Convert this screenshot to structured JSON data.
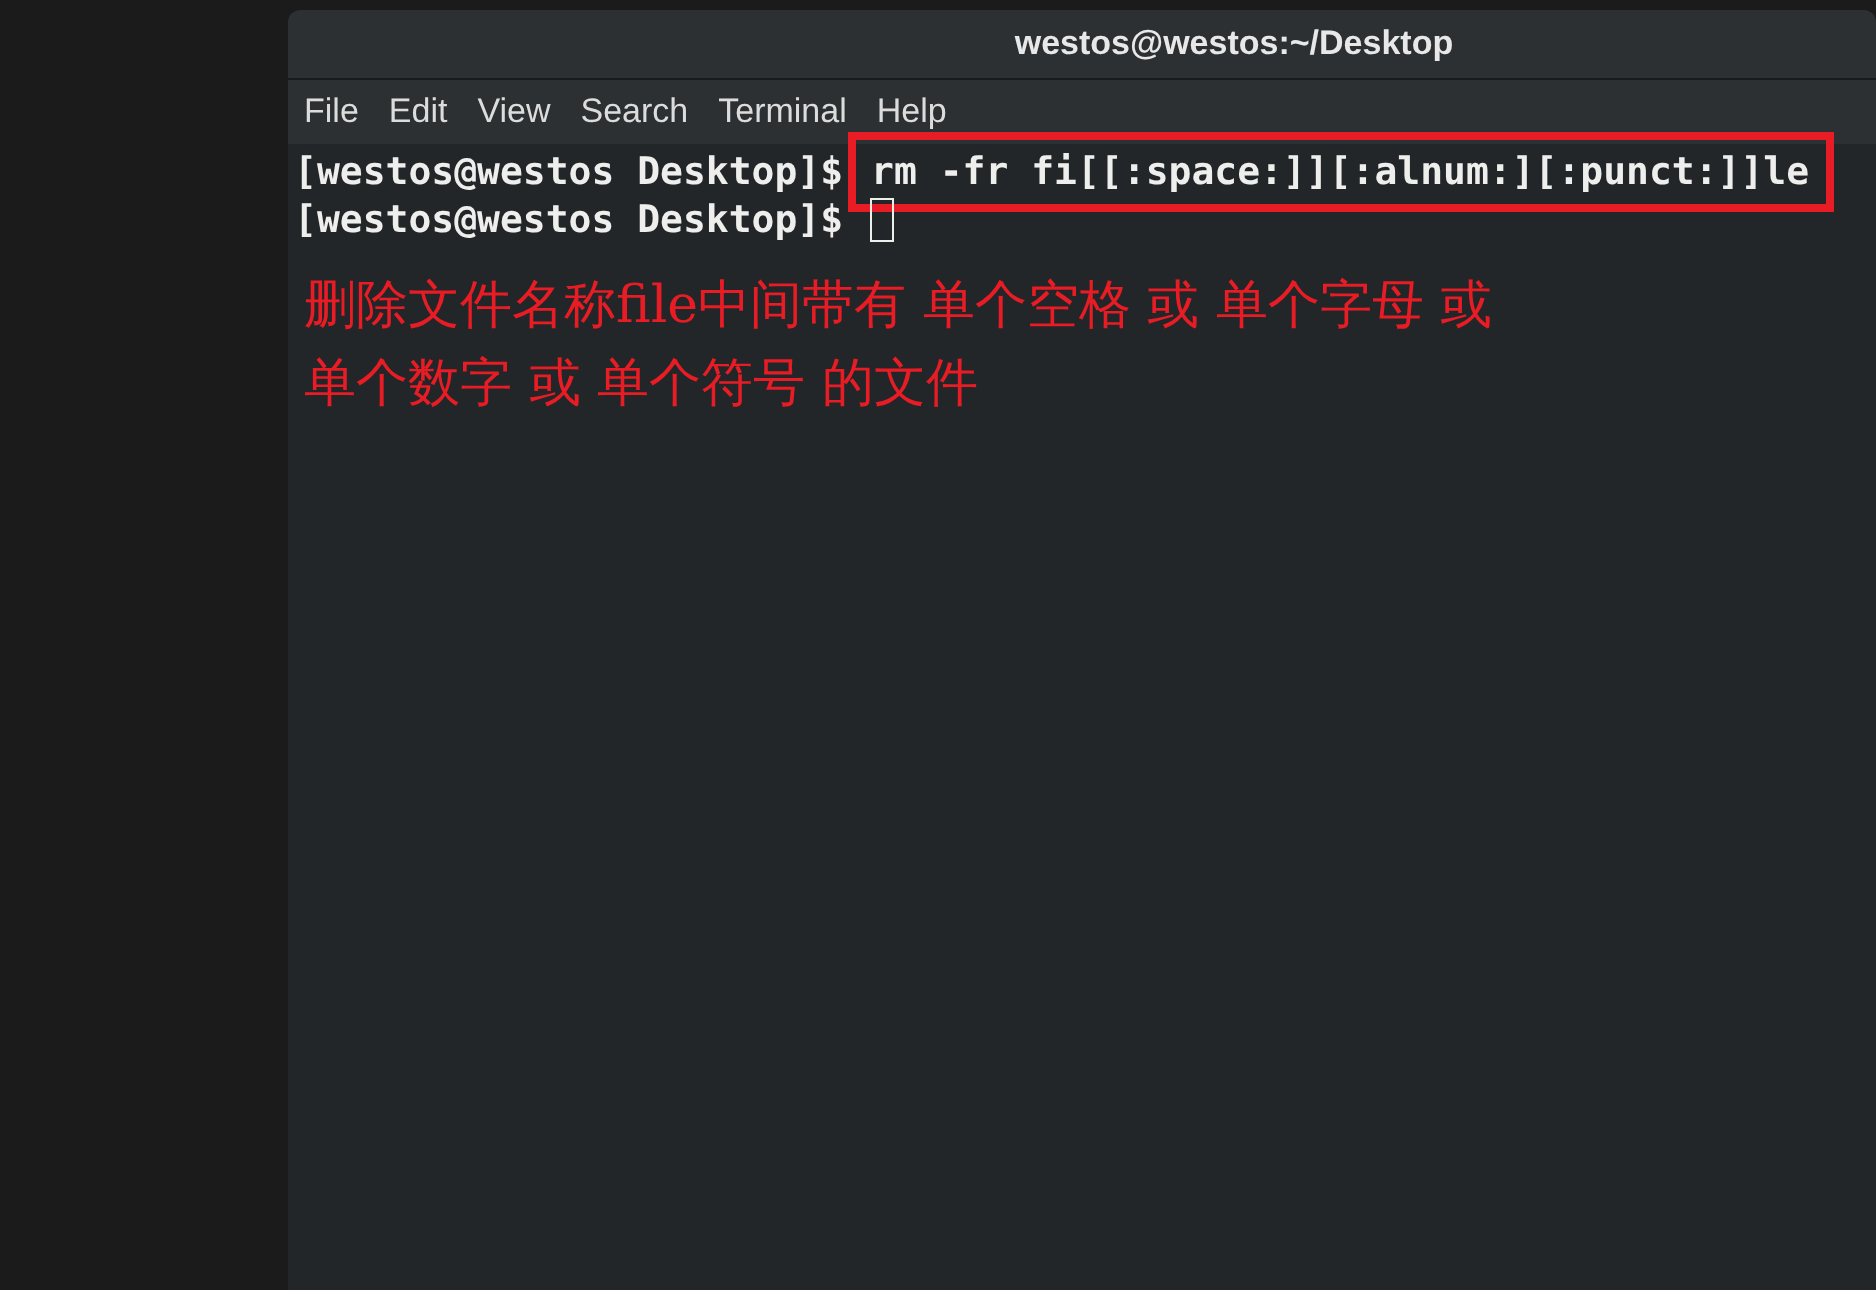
{
  "window": {
    "title": "westos@westos:~/Desktop"
  },
  "menu": [
    "File",
    "Edit",
    "View",
    "Search",
    "Terminal",
    "Help"
  ],
  "lines": [
    {
      "prompt": "[westos@westos Desktop]$",
      "command": "rm -fr fi[[:space:]][:alnum:][:punct:]]le"
    },
    {
      "prompt": "[westos@westos Desktop]$"
    }
  ],
  "annotation_lines": [
    "删除文件名称file中间带有 单个空格 或 单个字母 或",
    "单个数字 或 单个符号 的文件"
  ]
}
